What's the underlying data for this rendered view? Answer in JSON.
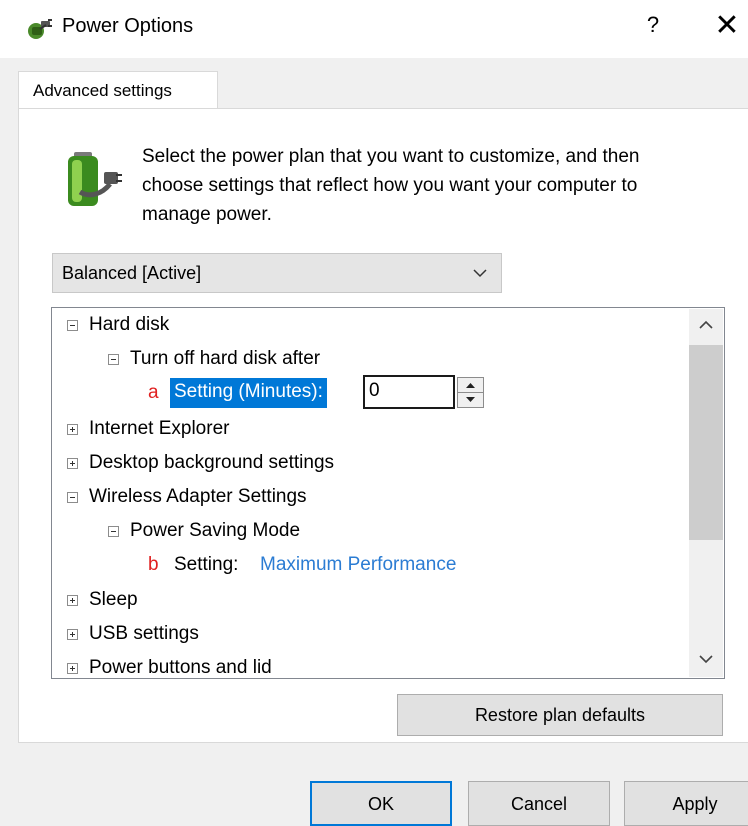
{
  "window": {
    "title": "Power Options",
    "help_label": "?",
    "close_label": "✕",
    "icon": "power-plug-icon"
  },
  "tabs": [
    {
      "label": "Advanced settings",
      "active": true
    }
  ],
  "intro": {
    "text": "Select the power plan that you want to customize, and then choose settings that reflect how you want your computer to manage power.",
    "icon": "battery-plug-icon"
  },
  "plan_select": {
    "value": "Balanced [Active]",
    "icon": "chevron-down-icon"
  },
  "tree": {
    "hard_disk": {
      "toggle": "−",
      "label": "Hard disk"
    },
    "turn_off_hard_disk": {
      "toggle": "−",
      "label": "Turn off hard disk after"
    },
    "minutes_setting": {
      "marker": "a",
      "label": "Setting (Minutes):",
      "value": "0"
    },
    "internet_explorer": {
      "toggle": "+",
      "label": "Internet Explorer"
    },
    "desktop_background": {
      "toggle": "+",
      "label": "Desktop background settings"
    },
    "wireless_adapter": {
      "toggle": "−",
      "label": "Wireless Adapter Settings"
    },
    "power_saving_mode": {
      "toggle": "−",
      "label": "Power Saving Mode"
    },
    "power_saving_setting": {
      "marker": "b",
      "label": "Setting:",
      "value": "Maximum Performance"
    },
    "sleep": {
      "toggle": "+",
      "label": "Sleep"
    },
    "usb_settings": {
      "toggle": "+",
      "label": "USB settings"
    },
    "power_buttons": {
      "toggle": "+",
      "label": "Power buttons and lid"
    }
  },
  "buttons": {
    "restore": "Restore plan defaults",
    "ok": "OK",
    "cancel": "Cancel",
    "apply": "Apply"
  },
  "colors": {
    "selection": "#0078d7",
    "link": "#2b7cd3",
    "marker": "#e02020"
  }
}
